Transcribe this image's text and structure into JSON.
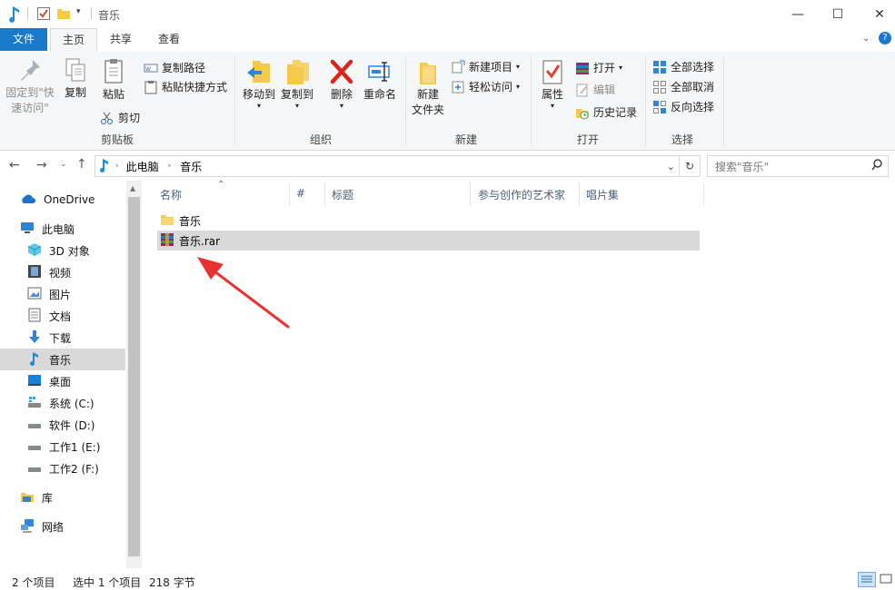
{
  "window": {
    "title": "音乐"
  },
  "tabs": [
    {
      "label": "文件"
    },
    {
      "label": "主页"
    },
    {
      "label": "共享"
    },
    {
      "label": "查看"
    }
  ],
  "ribbon": {
    "clipboard": {
      "pin_label_line1": "固定到\"快",
      "pin_label_line2": "速访问\"",
      "copy_label": "复制",
      "paste_label": "粘贴",
      "copy_path_label": "复制路径",
      "paste_shortcut_label": "粘贴快捷方式",
      "cut_label": "剪切",
      "group_label": "剪贴板"
    },
    "organize": {
      "move_to_label": "移动到",
      "copy_to_label": "复制到",
      "delete_label": "删除",
      "rename_label": "重命名",
      "group_label": "组织"
    },
    "new": {
      "new_folder_line1": "新建",
      "new_folder_line2": "文件夹",
      "new_item_label": "新建项目",
      "easy_access_label": "轻松访问",
      "group_label": "新建"
    },
    "open": {
      "properties_label": "属性",
      "open_label": "打开",
      "edit_label": "编辑",
      "history_label": "历史记录",
      "group_label": "打开"
    },
    "select": {
      "select_all_label": "全部选择",
      "select_none_label": "全部取消",
      "invert_label": "反向选择",
      "group_label": "选择"
    }
  },
  "address": {
    "crumbs": [
      "此电脑",
      "音乐"
    ],
    "search_placeholder": "搜索\"音乐\""
  },
  "nav": {
    "items": [
      {
        "label": "OneDrive"
      },
      {
        "label": "此电脑"
      },
      {
        "label": "3D 对象"
      },
      {
        "label": "视频"
      },
      {
        "label": "图片"
      },
      {
        "label": "文档"
      },
      {
        "label": "下载"
      },
      {
        "label": "音乐"
      },
      {
        "label": "桌面"
      },
      {
        "label": "系统 (C:)"
      },
      {
        "label": "软件 (D:)"
      },
      {
        "label": "工作1 (E:)"
      },
      {
        "label": "工作2 (F:)"
      },
      {
        "label": "库"
      },
      {
        "label": "网络"
      }
    ]
  },
  "columns": [
    "名称",
    "#",
    "标题",
    "参与创作的艺术家",
    "唱片集"
  ],
  "files": [
    {
      "name": "音乐",
      "type": "folder"
    },
    {
      "name": "音乐.rar",
      "type": "rar"
    }
  ],
  "status": {
    "item_count": "2 个项目",
    "selection": "选中 1 个项目",
    "size": "218 字节"
  },
  "colors": {
    "accent": "#1979ca",
    "selected_row": "#d9d9d9",
    "nav_selected": "#d9d9d9",
    "arrow": "#e8322f"
  }
}
